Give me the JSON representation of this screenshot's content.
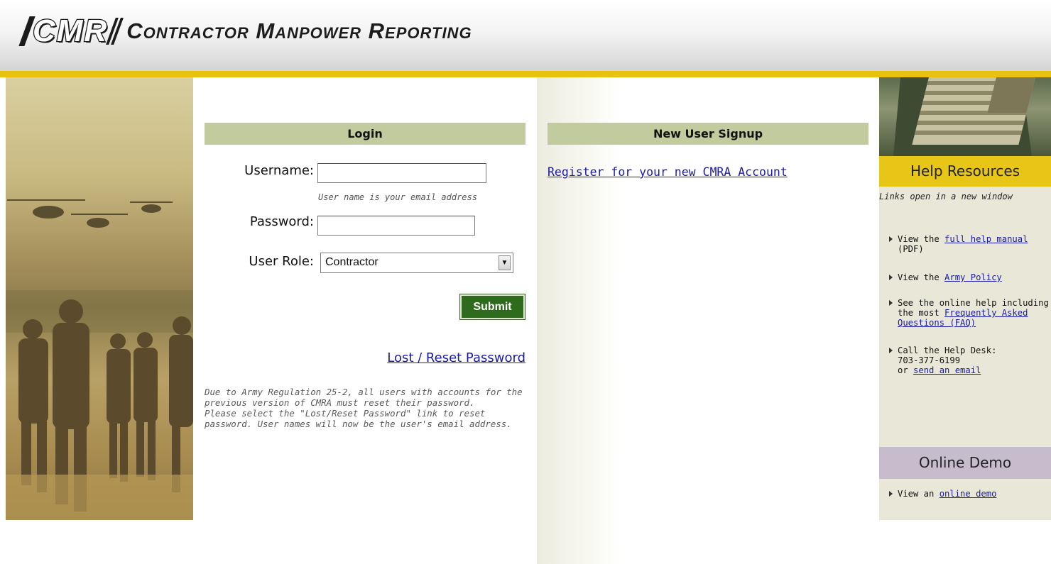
{
  "header": {
    "logo_acronym": "CMR",
    "logo_title": "Contractor Manpower Reporting"
  },
  "login": {
    "heading": "Login",
    "username_label": "Username:",
    "username_value": "",
    "username_hint": "User name is your email address",
    "password_label": "Password:",
    "password_value": "",
    "role_label": "User Role:",
    "role_selected": "Contractor",
    "submit_label": "Submit",
    "lost_password_link": "Lost / Reset Password",
    "notice_line1": "Due to Army Regulation 25-2, all users with accounts for the previous version of CMRA must reset their password.",
    "notice_line2": "Please select the \"Lost/Reset Password\" link to reset password. User names will now be the user's email address."
  },
  "signup": {
    "heading": "New User Signup",
    "register_link": "Register for your new CMRA Account"
  },
  "help": {
    "heading": "Help Resources",
    "note": "Links open in a new window",
    "item1_prefix": "View the ",
    "item1_link": "full help manual",
    "item1_suffix": " (PDF)",
    "item2_prefix": "View the ",
    "item2_link": "Army Policy",
    "item3_prefix": "See the online help including the most ",
    "item3_link": "Frequently Asked Questions (FAQ)",
    "item4_line1": "Call the Help Desk:",
    "item4_phone": "703-377-6199",
    "item4_or": "or ",
    "item4_link": "send an email"
  },
  "demo": {
    "heading": "Online Demo",
    "item_prefix": "View an ",
    "item_link": "online demo"
  },
  "colors": {
    "accent_yellow": "#e8c20e",
    "section_header_green": "#c1cb9e",
    "submit_green": "#2f6b1c",
    "demo_header_lilac": "#c6bccc",
    "link_blue": "#1a1aa6"
  }
}
